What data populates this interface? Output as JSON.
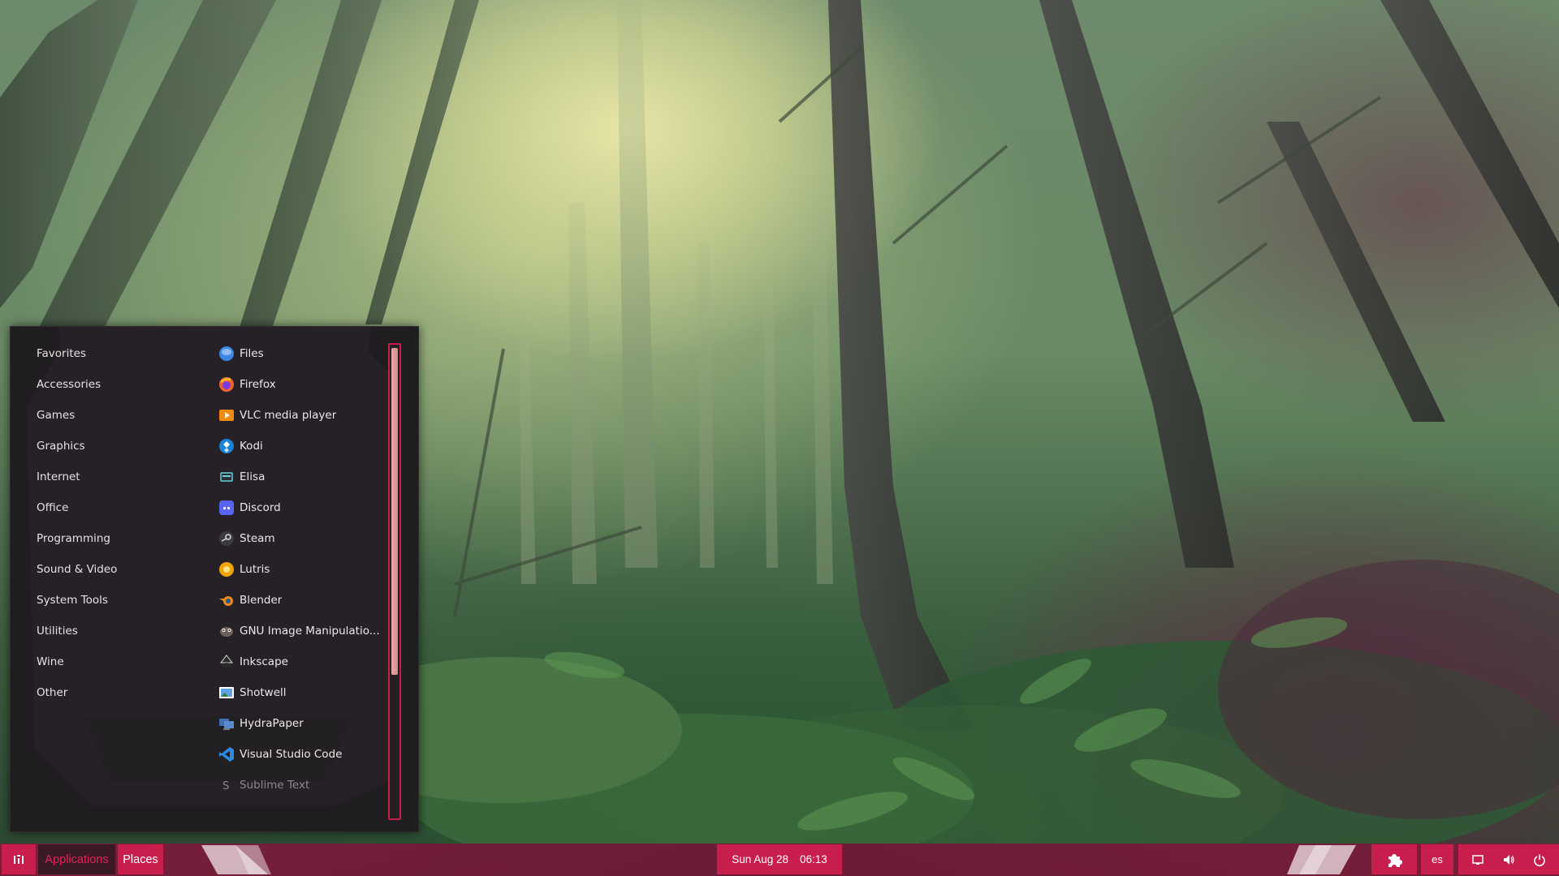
{
  "menu": {
    "categories": [
      "Favorites",
      "Accessories",
      "Games",
      "Graphics",
      "Internet",
      "Office",
      "Programming",
      "Sound & Video",
      "System Tools",
      "Utilities",
      "Wine",
      "Other"
    ],
    "apps": [
      {
        "label": "Files",
        "icon": "files-icon"
      },
      {
        "label": "Firefox",
        "icon": "firefox-icon"
      },
      {
        "label": "VLC media player",
        "icon": "vlc-icon"
      },
      {
        "label": "Kodi",
        "icon": "kodi-icon"
      },
      {
        "label": "Elisa",
        "icon": "elisa-icon"
      },
      {
        "label": "Discord",
        "icon": "discord-icon"
      },
      {
        "label": "Steam",
        "icon": "steam-icon"
      },
      {
        "label": "Lutris",
        "icon": "lutris-icon"
      },
      {
        "label": "Blender",
        "icon": "blender-icon"
      },
      {
        "label": "GNU Image Manipulatio...",
        "icon": "gimp-icon"
      },
      {
        "label": "Inkscape",
        "icon": "inkscape-icon"
      },
      {
        "label": "Shotwell",
        "icon": "shotwell-icon"
      },
      {
        "label": "HydraPaper",
        "icon": "hydrapaper-icon"
      },
      {
        "label": "Visual Studio Code",
        "icon": "vscode-icon"
      },
      {
        "label": "Sublime Text",
        "icon": "sublime-icon"
      }
    ],
    "scroll_fraction": 0.7
  },
  "panel": {
    "menu_icon": "app-grid-icon",
    "applications_label": "Applications",
    "places_label": "Places",
    "clock": {
      "date": "Sun Aug 28",
      "time": "06:13"
    },
    "extensions_icon": "puzzle-icon",
    "language": "es",
    "tray_icons": [
      "screen-icon",
      "volume-icon",
      "power-icon"
    ]
  },
  "colors": {
    "accent": "#c81e4d",
    "panel": "#6d1c36",
    "menu_bg": "#1f1d20",
    "scroll_thumb": "#e0a09d"
  }
}
